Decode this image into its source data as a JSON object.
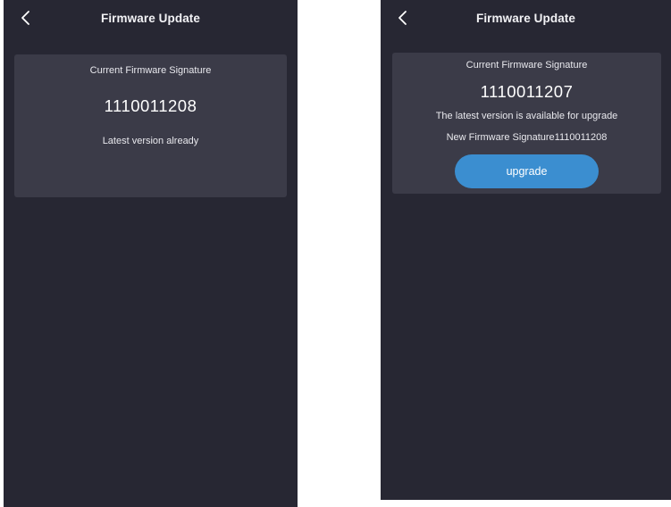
{
  "screens": [
    {
      "nav": {
        "title": "Firmware Update"
      },
      "card": {
        "label": "Current Firmware Signature",
        "signature": "1110011208",
        "status": "Latest version already"
      }
    },
    {
      "nav": {
        "title": "Firmware Update"
      },
      "card": {
        "label": "Current Firmware Signature",
        "signature": "1110011207",
        "status": "The latest version is available for upgrade",
        "new_signature": "New Firmware Signature1110011208",
        "upgrade_label": "upgrade"
      }
    }
  ],
  "icons": {
    "back": "chevron-left-icon"
  },
  "colors": {
    "background": "#272733",
    "card": "#3b3b48",
    "accent": "#3b8ed0",
    "text": "#ffffff"
  }
}
